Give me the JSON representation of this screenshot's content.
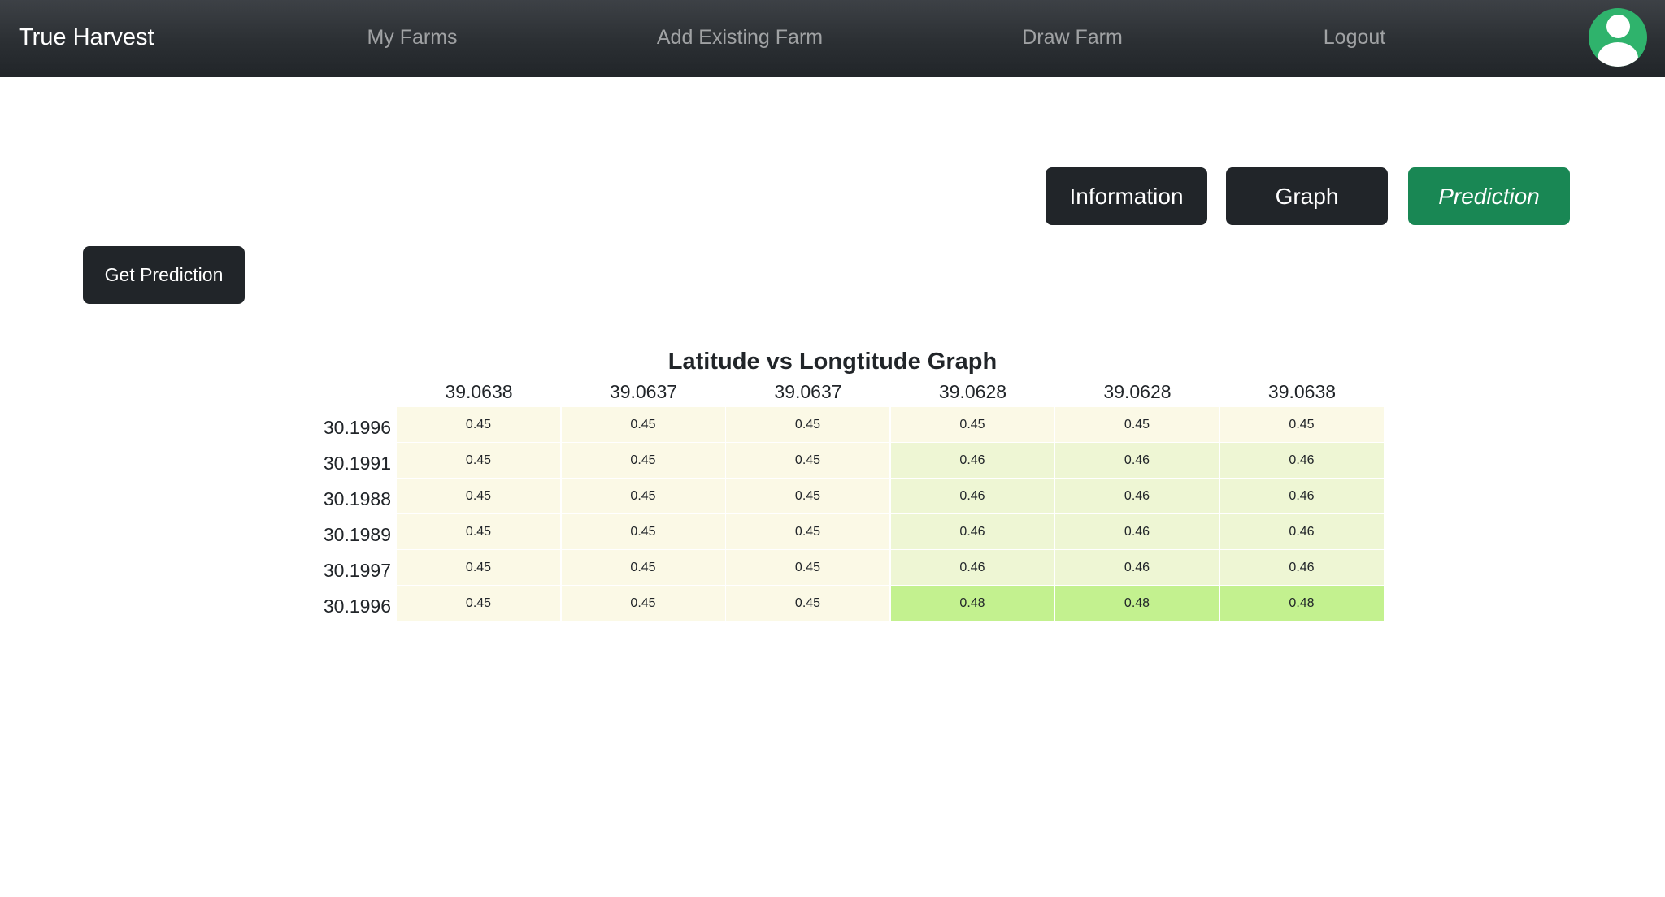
{
  "navbar": {
    "brand": "True Harvest",
    "links": [
      "My Farms",
      "Add Existing Farm",
      "Draw Farm",
      "Logout"
    ]
  },
  "tabs": {
    "information": "Information",
    "graph": "Graph",
    "prediction": "Prediction",
    "active": "Prediction"
  },
  "actions": {
    "get_prediction": "Get Prediction"
  },
  "chart_data": {
    "type": "heatmap",
    "title": "Latitude vs Longtitude Graph",
    "x_labels": [
      "39.0638",
      "39.0637",
      "39.0637",
      "39.0628",
      "39.0628",
      "39.0638"
    ],
    "y_labels": [
      "30.1996",
      "30.1991",
      "30.1988",
      "30.1989",
      "30.1997",
      "30.1996"
    ],
    "values": [
      [
        0.45,
        0.45,
        0.45,
        0.45,
        0.45,
        0.45
      ],
      [
        0.45,
        0.45,
        0.45,
        0.46,
        0.46,
        0.46
      ],
      [
        0.45,
        0.45,
        0.45,
        0.46,
        0.46,
        0.46
      ],
      [
        0.45,
        0.45,
        0.45,
        0.46,
        0.46,
        0.46
      ],
      [
        0.45,
        0.45,
        0.45,
        0.46,
        0.46,
        0.46
      ],
      [
        0.45,
        0.45,
        0.45,
        0.48,
        0.48,
        0.48
      ]
    ],
    "color_scale": {
      "0.45": "#fbf9e6",
      "0.46": "#eef6d4",
      "0.48": "#c3f18f"
    }
  }
}
